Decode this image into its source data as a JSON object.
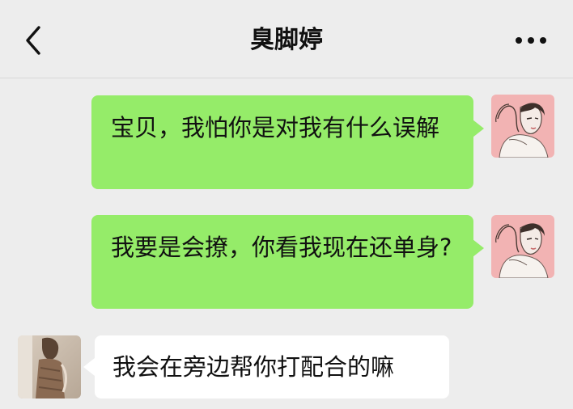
{
  "header": {
    "title": "臭脚婷",
    "back_icon": "chevron-left-icon",
    "more_icon": "ellipsis-icon"
  },
  "colors": {
    "background": "#ededed",
    "outgoing_bubble": "#95ec69",
    "incoming_bubble": "#ffffff",
    "my_avatar_bg": "#f2b3b3"
  },
  "messages": [
    {
      "sender": "me",
      "text": "宝贝，我怕你是对我有什么误解"
    },
    {
      "sender": "me",
      "text": "我要是会撩，你看我现在还单身?"
    },
    {
      "sender": "contact",
      "text": "我会在旁边帮你打配合的嘛"
    }
  ]
}
